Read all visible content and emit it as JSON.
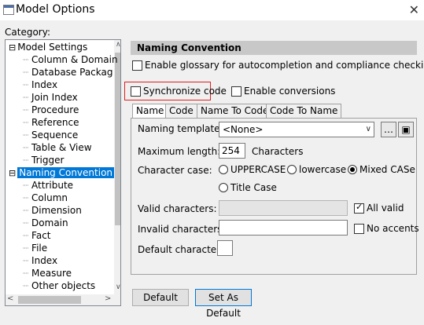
{
  "window": {
    "title": "Model Options",
    "close": "✕"
  },
  "category_label": "Category:",
  "tree": {
    "items": [
      {
        "label": "Model Settings",
        "level": 0,
        "expander": "⊟"
      },
      {
        "label": "Column & Domain",
        "level": 1
      },
      {
        "label": "Database Packag",
        "level": 1
      },
      {
        "label": "Index",
        "level": 1
      },
      {
        "label": "Join Index",
        "level": 1
      },
      {
        "label": "Procedure",
        "level": 1
      },
      {
        "label": "Reference",
        "level": 1
      },
      {
        "label": "Sequence",
        "level": 1
      },
      {
        "label": "Table & View",
        "level": 1
      },
      {
        "label": "Trigger",
        "level": 1
      },
      {
        "label": "Naming Convention",
        "level": 0,
        "expander": "⊟",
        "selected": true
      },
      {
        "label": "Attribute",
        "level": 1
      },
      {
        "label": "Column",
        "level": 1
      },
      {
        "label": "Dimension",
        "level": 1
      },
      {
        "label": "Domain",
        "level": 1
      },
      {
        "label": "Fact",
        "level": 1
      },
      {
        "label": "File",
        "level": 1
      },
      {
        "label": "Index",
        "level": 1
      },
      {
        "label": "Measure",
        "level": 1
      },
      {
        "label": "Other objects",
        "level": 1
      }
    ]
  },
  "panel": {
    "header": "Naming Convention",
    "glossary_label": "Enable glossary for autocompletion and compliance checking",
    "sync_label": "Synchronize code",
    "conversions_label": "Enable conversions"
  },
  "tabs": [
    "Name",
    "Code",
    "Name To Code",
    "Code To Name"
  ],
  "form": {
    "naming_template_label": "Naming template:",
    "naming_template_value": "<None>",
    "max_length_label": "Maximum length:",
    "max_length_value": "254",
    "characters_label": "Characters",
    "case_label": "Character case:",
    "case_uppercase": "UPPERCASE",
    "case_lowercase": "lowercase",
    "case_mixed": "Mixed CASe",
    "case_title": "Title Case",
    "valid_label": "Valid characters:",
    "all_valid_label": "All valid",
    "invalid_label": "Invalid characters:",
    "no_accents_label": "No accents",
    "default_char_label": "Default character:"
  },
  "buttons": {
    "default": "Default",
    "set_as_default": "Set As Default"
  }
}
